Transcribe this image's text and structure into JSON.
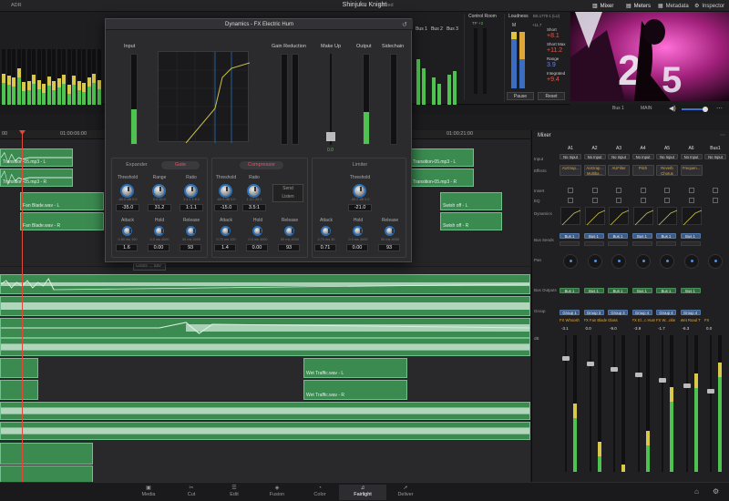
{
  "app": {
    "label": "ADR",
    "project": "Shinjuku Knight",
    "status": "Edited"
  },
  "top_tabs": [
    {
      "label": "Mixer",
      "icon": "mixer-icon"
    },
    {
      "label": "Meters",
      "icon": "meters-icon"
    },
    {
      "label": "Metadata",
      "icon": "metadata-icon"
    },
    {
      "label": "Inspector",
      "icon": "inspector-icon"
    }
  ],
  "meters": {
    "bus_labels": [
      "Bus 1",
      "Bus 2",
      "Bus 3"
    ],
    "control_room": {
      "title": "Control Room",
      "sub": "TP",
      "val": "+2"
    },
    "loudness": {
      "title": "Loudness",
      "standard": "BS.1770-1 (LU)",
      "scale_top": "+11.7",
      "m_label": "M",
      "short_label": "Short",
      "short_val": "+8.1",
      "short_max_label": "Short Max",
      "short_max_val": "+11.2",
      "range_label": "Range",
      "range_val": "3.9",
      "integrated_label": "Integrated",
      "integrated_val": "+9.4",
      "pause": "Pause",
      "reset": "Reset"
    }
  },
  "toolbar2": {
    "bus": "Bus 1",
    "main": "MAIN"
  },
  "ruler": {
    "t1": "00",
    "t2": "01:00:06:00",
    "t3": "01:00:21:00"
  },
  "dynamics": {
    "title": "Dynamics - FX Electric Hum",
    "headers": {
      "input": "Input",
      "gain_reduction": "Gain Reduction",
      "makeup": "Make Up",
      "output": "Output",
      "sidechain": "Sidechain"
    },
    "makeup_val": "0.0",
    "tabs": {
      "expander": "Expander",
      "gate": "Gate",
      "compressor": "Compressor",
      "limiter": "Limiter"
    },
    "gate": {
      "threshold": {
        "label": "Threshold",
        "value": "-35.0",
        "min": "-50.0 dB",
        "max": "0.0"
      },
      "range": {
        "label": "Range",
        "value": "31.2",
        "min": "0.0",
        "max": "60.0"
      },
      "ratio": {
        "label": "Ratio",
        "value": "1:1.1",
        "min": "1:1.1",
        "max": "1:5.0"
      },
      "attack": {
        "label": "Attack",
        "value": "1.6",
        "min": "0.50",
        "unit": "ms",
        "max": "100"
      },
      "hold": {
        "label": "Hold",
        "value": "0.00",
        "min": "0.0",
        "unit": "ms",
        "max": "4000"
      },
      "release": {
        "label": "Release",
        "value": "93",
        "min": "50",
        "unit": "ms",
        "max": "4000"
      }
    },
    "compressor": {
      "threshold": {
        "label": "Threshold",
        "value": "-15.0",
        "min": "-60.0 dB",
        "max": "0.0"
      },
      "ratio": {
        "label": "Ratio",
        "value": "3.5:1",
        "min": "1.3:1",
        "max": "20:1"
      },
      "send": "Send",
      "listen": "Listen",
      "attack": {
        "label": "Attack",
        "value": "1.4",
        "min": "0.70",
        "unit": "ms",
        "max": "100"
      },
      "hold": {
        "label": "Hold",
        "value": "0.00",
        "min": "0.0",
        "unit": "ms",
        "max": "4000"
      },
      "release": {
        "label": "Release",
        "value": "93",
        "min": "50",
        "unit": "ms",
        "max": "4000"
      }
    },
    "limiter": {
      "threshold": {
        "label": "Threshold",
        "value": "-21.0",
        "min": "-30.0 dB",
        "max": "0.0"
      },
      "attack": {
        "label": "Attack",
        "value": "0.71",
        "min": "0.70",
        "unit": "ms",
        "max": "30"
      },
      "hold": {
        "label": "Hold",
        "value": "0.00",
        "min": "0.0",
        "unit": "ms",
        "max": "4000"
      },
      "release": {
        "label": "Release",
        "value": "93",
        "min": "50",
        "unit": "ms",
        "max": "4000"
      }
    }
  },
  "clips": {
    "c1": "Transition-05.mp3 - L",
    "c2": "Transition-05.mp3 - R",
    "c3": "Fan Blade.wav - L",
    "c4": "Fan Blade.wav - R",
    "c5": "Transition-05.mp3 - L",
    "c6": "Transition-05.mp3 - R",
    "c7": "Swish off - L",
    "c8": "Swish off - R",
    "c9": "Glass ... aav",
    "c10": "Wet Traffic.wav - L",
    "c11": "Wet Traffic.wav - R"
  },
  "mixer": {
    "title": "Mixer",
    "channels": [
      "A1",
      "A2",
      "A3",
      "A4",
      "A5",
      "A6",
      "Bus1"
    ],
    "row_labels": {
      "input": "Input",
      "effects": "Effects",
      "insert": "Insert",
      "eq": "EQ",
      "dynamics": "Dynamics",
      "bus_sends": "Bus Sends",
      "pan": "Pan",
      "bus_outputs": "Bus Outputs",
      "group": "Group",
      "db": "dB"
    },
    "input": [
      "No Input",
      "No Input",
      "No Input",
      "No Input",
      "No Input",
      "No Input",
      "No Input"
    ],
    "effects": [
      "AUGrap...",
      "AUGrap... Multiba...",
      "AUFilter",
      "Pitch",
      "Reverb Chorus",
      "Frequen...",
      ""
    ],
    "bus_sends": [
      "Bus 1",
      "Bus 1",
      "Bus 1",
      "Bus 1",
      "Bus 1",
      "Bus 1"
    ],
    "bus_outputs": [
      "Bus 1",
      "Bus 1",
      "Bus 1",
      "Bus 1",
      "Bus 1",
      "Bus 1"
    ],
    "groups": [
      "Group 1",
      "Group 3",
      "Group 3",
      "Group 4",
      "Group 4",
      "Group 4"
    ],
    "names": [
      "FX Whoosh",
      "FX Fan Blade",
      "Glass",
      "FX El...c Hum",
      "FX W...ckle",
      "Wet Road T",
      "FX"
    ],
    "db": [
      "-3.1",
      "0.0",
      "-9.0",
      "-3.9",
      "-1.7",
      "-6.3",
      "0.0"
    ]
  },
  "pages": [
    {
      "label": "Media",
      "icon": "media-icon"
    },
    {
      "label": "Cut",
      "icon": "cut-icon"
    },
    {
      "label": "Edit",
      "icon": "edit-icon"
    },
    {
      "label": "Fusion",
      "icon": "fusion-icon"
    },
    {
      "label": "Color",
      "icon": "color-icon"
    },
    {
      "label": "Fairlight",
      "icon": "fairlight-icon"
    },
    {
      "label": "Deliver",
      "icon": "deliver-icon"
    }
  ],
  "colors": {
    "accent_green": "#4fc34f",
    "clip_green": "#3b8a50",
    "playhead": "#e04a3a",
    "gate_red": "#e9545f",
    "knob_ring": "#2a6fb5"
  }
}
